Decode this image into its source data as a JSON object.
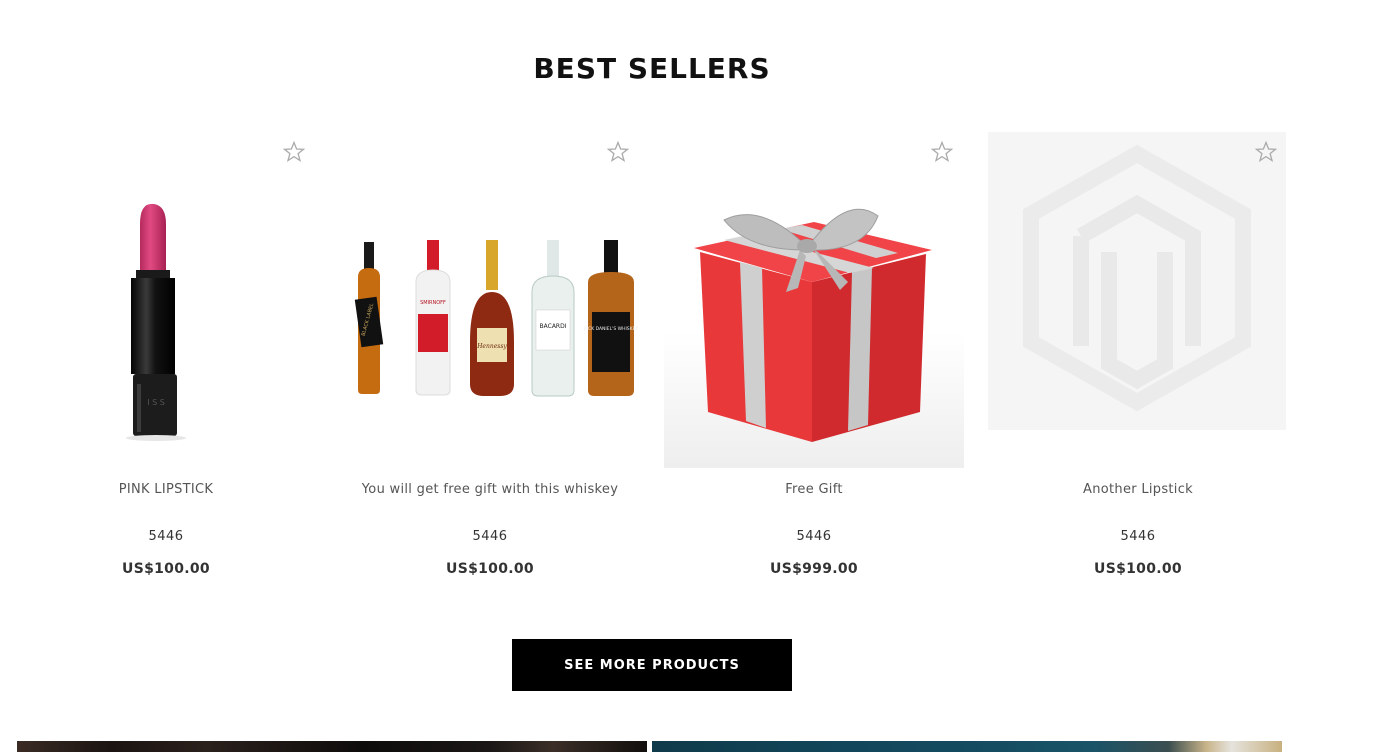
{
  "section": {
    "title": "BEST SELLERS"
  },
  "products": [
    {
      "name": "PINK LIPSTICK",
      "sku": "5446",
      "price": "US$100.00",
      "image_icon": "lipstick-image",
      "wishlist_icon": "star-outline-icon"
    },
    {
      "name": "You will get free gift with this whiskey",
      "sku": "5446",
      "price": "US$100.00",
      "image_icon": "liquor-bottles-image",
      "bottle_labels": [
        "BLACK LABEL",
        "SMIRNOFF",
        "Hennessy",
        "BACARDI",
        "JACK DANIEL'S WHISKEY"
      ],
      "wishlist_icon": "star-outline-icon"
    },
    {
      "name": "Free Gift",
      "sku": "5446",
      "price": "US$999.00",
      "image_icon": "gift-box-image",
      "wishlist_icon": "star-outline-icon"
    },
    {
      "name": "Another Lipstick",
      "sku": "5446",
      "price": "US$100.00",
      "image_icon": "placeholder-logo-image",
      "wishlist_icon": "star-outline-icon"
    }
  ],
  "cta": {
    "label": "SEE MORE PRODUCTS"
  },
  "colors": {
    "button_bg": "#000000",
    "button_text": "#ffffff",
    "gift_red": "#e8383a",
    "ribbon_silver": "#c9c9c9",
    "lipstick_pink": "#d63a72"
  }
}
